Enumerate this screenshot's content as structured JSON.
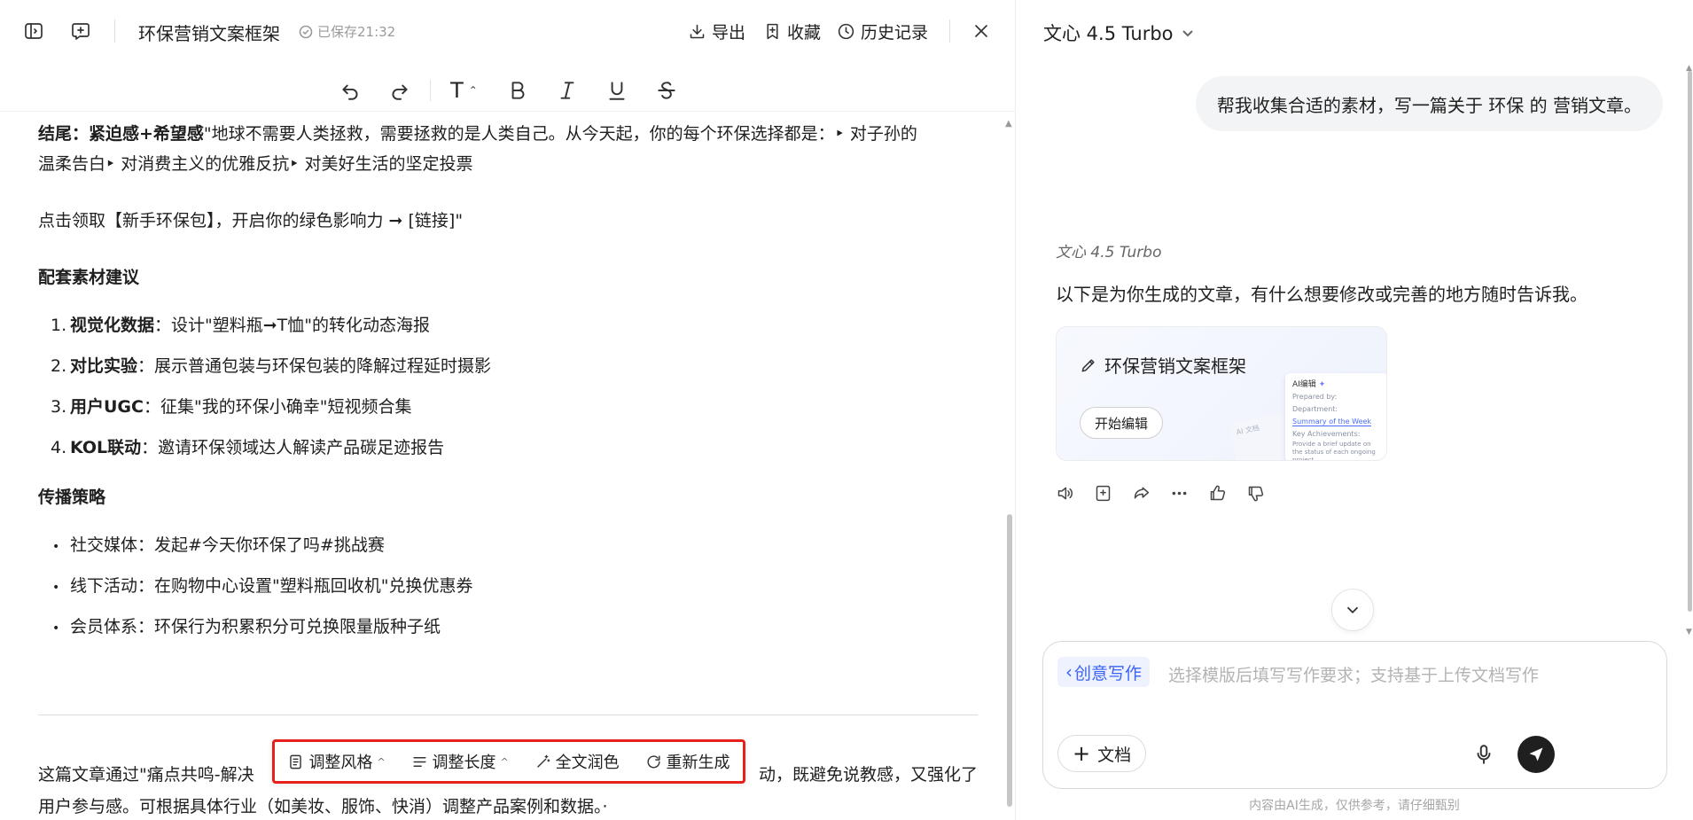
{
  "editor": {
    "doc_title": "环保营销文案框架",
    "saved_status": "已保存21:32",
    "toolbar": {
      "export_label": "导出",
      "favorite_label": "收藏",
      "history_label": "历史记录"
    },
    "format": {
      "text_style_label": "T"
    }
  },
  "content": {
    "ending_label": "结尾：紧迫感+希望感",
    "ending_line1": "\"地球不需要人类拯救，需要拯救的是人类自己。从今天起，你的每个环保选择都是：‣ 对子孙的",
    "ending_line2": "温柔告白‣ 对消费主义的优雅反抗‣ 对美好生活的坚定投票",
    "cta": "点击领取【新手环保包】，开启你的绿色影响力 ➞ [链接]\"",
    "materials_heading": "配套素材建议",
    "materials": [
      {
        "num": "1.",
        "label": "视觉化数据",
        "text": "：设计\"塑料瓶➞T恤\"的转化动态海报"
      },
      {
        "num": "2.",
        "label": "对比实验",
        "text": "：展示普通包装与环保包装的降解过程延时摄影"
      },
      {
        "num": "3.",
        "label": "用户UGC",
        "text": "：征集\"我的环保小确幸\"短视频合集"
      },
      {
        "num": "4.",
        "label": "KOL联动",
        "text": "：邀请环保领域达人解读产品碳足迹报告"
      }
    ],
    "strategy_heading": "传播策略",
    "strategy": [
      {
        "text": "社交媒体：发起#今天你环保了吗#挑战赛"
      },
      {
        "text": "线下活动：在购物中心设置\"塑料瓶回收机\"兑换优惠券"
      },
      {
        "text": "会员体系：环保行为积累积分可兑换限量版种子纸"
      }
    ],
    "summary_line1_start": "这篇文章通过\"痛点共鸣-解决",
    "summary_line1_end": "动，既避免说教感，又强化了",
    "summary_line2": "用户参与感。可根据具体行业（如美妆、服饰、快消）调整产品案例和数据。·"
  },
  "float_toolbar": {
    "adjust_style": "调整风格",
    "adjust_length": "调整长度",
    "polish": "全文润色",
    "regenerate": "重新生成"
  },
  "chat": {
    "model_name": "文心 4.5 Turbo",
    "user_message": "帮我收集合适的素材，写一篇关于 环保 的 营销文章。",
    "ai_name": "文心 4.5 Turbo",
    "ai_message": "以下是为你生成的文章，有什么想要修改或完善的地方随时告诉我。",
    "doc_card": {
      "title": "环保营销文案框架",
      "button": "开始编辑",
      "mini_title": "AI编辑",
      "mini_prepared": "Prepared by:",
      "mini_department": "Department:",
      "mini_summary": "Summary of the Week",
      "mini_achievements": "Key Achievements:",
      "mini_body": "Provide a brief update on the status of each ongoing project",
      "mini_back": "AI 文档"
    },
    "input": {
      "chip_label": "创意写作",
      "placeholder": "选择模版后填写写作要求；支持基于上传文档写作",
      "doc_button": "文档"
    },
    "disclaimer": "内容由AI生成，仅供参考，请仔细甄别"
  }
}
